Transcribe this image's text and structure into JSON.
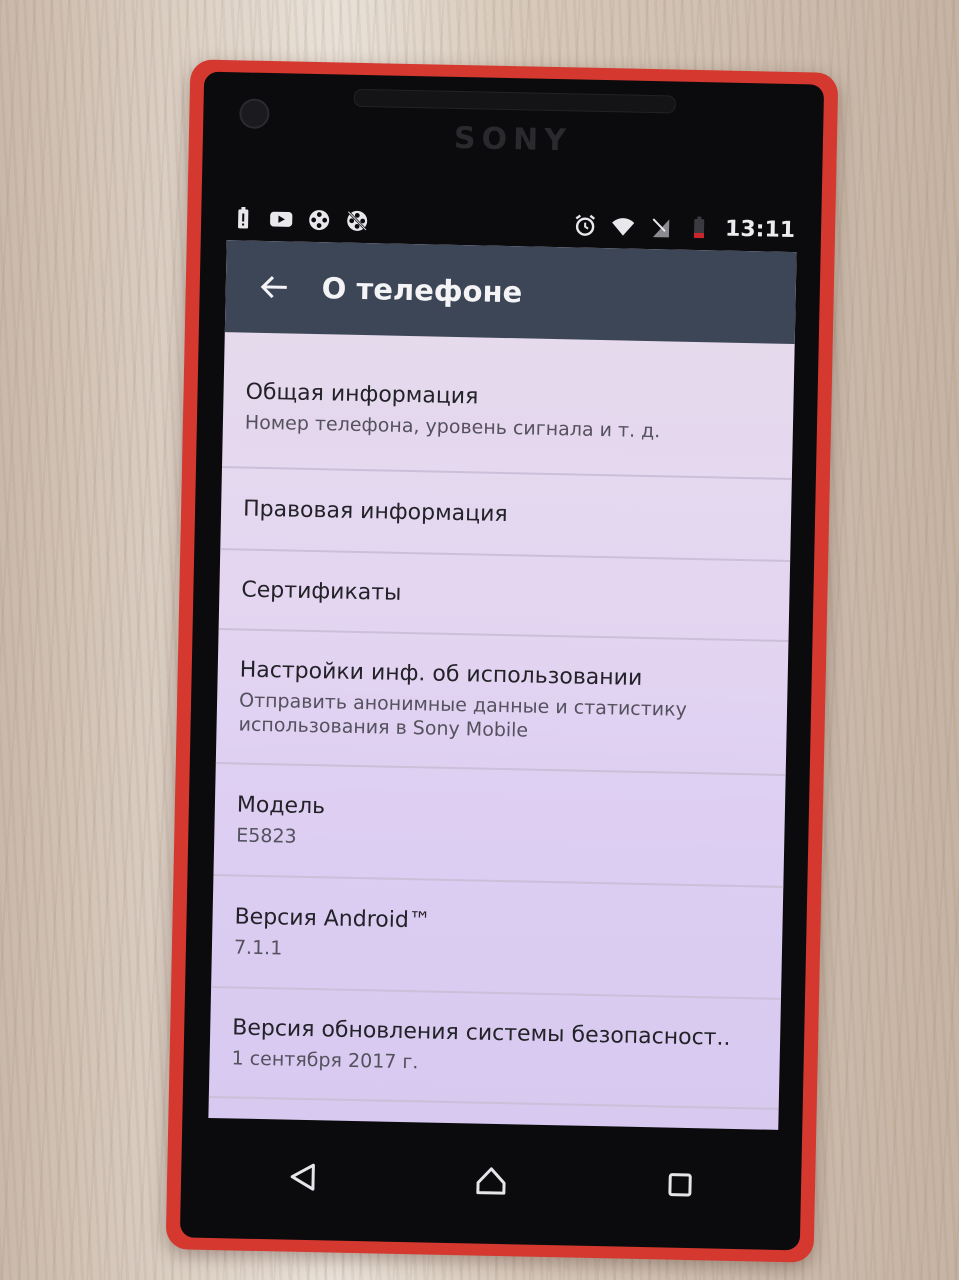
{
  "device": {
    "brand": "SONY"
  },
  "status_bar": {
    "time": "13:11",
    "left_icons": [
      "battery-alert-icon",
      "youtube-icon",
      "film-reel-icon",
      "film-reel-off-icon"
    ],
    "right_icons": [
      "alarm-icon",
      "wifi-icon",
      "signal-off-icon",
      "battery-low-icon"
    ]
  },
  "app_bar": {
    "title": "О телефоне",
    "back_icon": "arrow-back-icon"
  },
  "settings": {
    "items": [
      {
        "title": "Общая информация",
        "subtitle": "Номер телефона, уровень сигнала и т. д."
      },
      {
        "title": "Правовая информация"
      },
      {
        "title": "Сертификаты"
      },
      {
        "title": "Настройки инф. об использовании",
        "subtitle": "Отправить анонимные данные и статистику использования в Sony Mobile"
      },
      {
        "title": "Модель",
        "subtitle": "E5823"
      },
      {
        "title": "Версия Android™",
        "subtitle": "7.1.1"
      },
      {
        "title": "Версия обновления системы безопасност..",
        "subtitle": "1 сентября 2017 г."
      }
    ]
  },
  "nav_bar": {
    "icons": [
      "back-triangle-icon",
      "home-icon",
      "recents-icon"
    ]
  },
  "colors": {
    "app_bar": "#3c4656",
    "phone_frame": "#d5382e",
    "screen_bg": "#e2d6ef"
  }
}
